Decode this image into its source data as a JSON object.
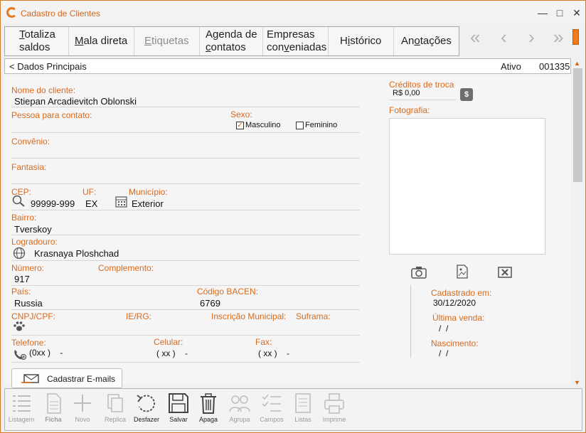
{
  "window": {
    "title": "Cadastro de Clientes",
    "minimize": "—",
    "maximize": "□",
    "close": "✕"
  },
  "top_tabs": [
    {
      "label_u": "T",
      "label_rest": "otaliza",
      "label2": "saldos",
      "state": "enabled"
    },
    {
      "label_u": "M",
      "label_rest": "ala direta",
      "state": "enabled"
    },
    {
      "label_u": "E",
      "label_rest": "tiquetas",
      "state": "disabled"
    },
    {
      "label1": "Agenda de",
      "label2_u": "c",
      "label2_rest": "ontatos",
      "state": "enabled"
    },
    {
      "label1": "Empresas",
      "label2_pre": "con",
      "label2_u": "v",
      "label2_rest": "eniadas",
      "state": "enabled"
    },
    {
      "label_pre": "H",
      "label_u": "i",
      "label_rest": "stórico",
      "state": "enabled"
    },
    {
      "label_pre": "An",
      "label_u": "o",
      "label_rest": "tações",
      "state": "enabled"
    }
  ],
  "nav": {
    "first": "«",
    "prev": "‹",
    "next": "›",
    "last": "»"
  },
  "section": {
    "title": "< Dados Principais",
    "status": "Ativo",
    "code": "001335"
  },
  "form": {
    "nome_label": "Nome do cliente:",
    "nome_value": "Stiepan Arcadievitch Oblonski",
    "contato_label": "Pessoa para contato:",
    "sexo_label": "Sexo:",
    "masculino": "Masculino",
    "feminino": "Feminino",
    "masculino_checked": "✓",
    "convenio_label": "Convênio:",
    "fantasia_label": "Fantasia:",
    "cep_label": "CEP:",
    "cep_value": "99999-999",
    "uf_label": "UF:",
    "uf_value": "EX",
    "municipio_label": "Município:",
    "municipio_value": "Exterior",
    "bairro_label": "Bairro:",
    "bairro_value": "Tverskoy",
    "logradouro_label": "Logradouro:",
    "logradouro_value": "Krasnaya Ploshchad",
    "numero_label": "Número:",
    "numero_value": "917",
    "complemento_label": "Complemento:",
    "pais_label": "País:",
    "pais_value": "Russia",
    "bacen_label": "Código BACEN:",
    "bacen_value": "6769",
    "cnpj_label": "CNPJ/CPF:",
    "ie_label": "IE/RG:",
    "im_label": "Inscrição Municipal:",
    "suframa_label": "Suframa:",
    "telefone_label": "Telefone:",
    "telefone_value": "(0xx )    -",
    "celular_label": "Celular:",
    "celular_value": "( xx )    -",
    "fax_label": "Fax:",
    "fax_value": "( xx )    -"
  },
  "right_panel": {
    "creditos_label": "Créditos de troca",
    "creditos_value": "R$ 0,00",
    "dollar_btn": "$",
    "foto_label": "Fotografia:",
    "cadastrado_label": "Cadastrado em:",
    "cadastrado_value": "30/12/2020",
    "ultima_venda_label": "Última venda:",
    "ultima_venda_value": "/  /",
    "nascimento_label": "Nascimento:",
    "nascimento_value": "/  /"
  },
  "email_button": "Cadastrar E-mails",
  "bottom_toolbar": [
    {
      "label": "Listagem",
      "icon": "list-icon",
      "enabled": false
    },
    {
      "label": "Ficha",
      "icon": "document-icon",
      "enabled": false
    },
    {
      "label": "Novo",
      "icon": "plus-icon",
      "enabled": false
    },
    {
      "label": "Replica",
      "icon": "copy-icon",
      "enabled": false
    },
    {
      "label": "Desfazer",
      "icon": "undo-icon",
      "enabled": true
    },
    {
      "label": "Salvar",
      "icon": "save-icon",
      "enabled": true
    },
    {
      "label": "Apaga",
      "icon": "trash-icon",
      "enabled": true
    },
    {
      "label": "Agrupa",
      "icon": "group-icon",
      "enabled": false
    },
    {
      "label": "Campos",
      "icon": "checklist-icon",
      "enabled": false
    },
    {
      "label": "Listas",
      "icon": "lists-icon",
      "enabled": false
    },
    {
      "label": "Imprime",
      "icon": "printer-icon",
      "enabled": false
    }
  ],
  "colors": {
    "accent": "#d86a1c",
    "border": "#d37a2a",
    "nav_disabled": "#b2b2b2"
  }
}
